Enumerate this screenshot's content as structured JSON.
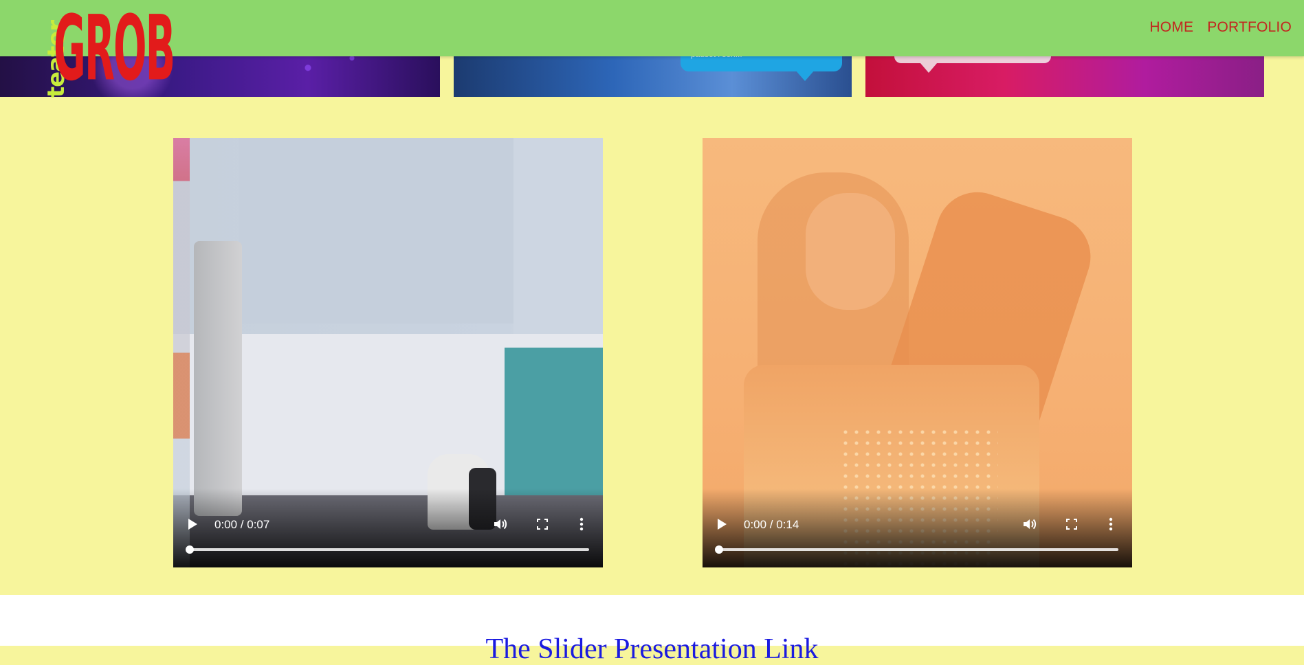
{
  "header": {
    "nav": [
      {
        "label": "HOME"
      },
      {
        "label": "PORTFOLIO"
      }
    ]
  },
  "logo": {
    "small_text": "teater",
    "big_text": "GROB",
    "colors": {
      "small": "#c8ec3c",
      "big": "#e21b1b"
    }
  },
  "strip": {
    "bubble_text": "pauset i sen..."
  },
  "videos": [
    {
      "time": "0:00 / 0:07",
      "progress": 0
    },
    {
      "time": "0:00 / 0:14",
      "progress": 0
    }
  ],
  "footer_section": {
    "heading": "The Slider Presentation Link"
  },
  "colors": {
    "page_background": "#f7f59c",
    "header_background": "#8cd76b",
    "nav_text": "#c2261f",
    "heading_text": "#1b1be0"
  }
}
